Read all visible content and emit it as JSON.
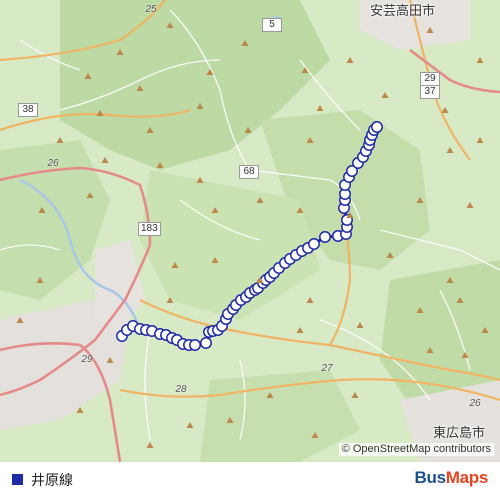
{
  "map": {
    "places": [
      {
        "id": "akitakata",
        "label": "安芸高田市"
      },
      {
        "id": "higashihiroshima",
        "label": "東広島市"
      }
    ],
    "road_shields": [
      {
        "id": "r25",
        "label": "25",
        "style": "plain"
      },
      {
        "id": "r5",
        "label": "5",
        "style": "box"
      },
      {
        "id": "r29a",
        "label": "29",
        "style": "box"
      },
      {
        "id": "r37",
        "label": "37",
        "style": "box"
      },
      {
        "id": "r38",
        "label": "38",
        "style": "box"
      },
      {
        "id": "r26",
        "label": "26",
        "style": "plain"
      },
      {
        "id": "r68",
        "label": "68",
        "style": "box"
      },
      {
        "id": "r183",
        "label": "183",
        "style": "box"
      },
      {
        "id": "r29b",
        "label": "29",
        "style": "plain"
      },
      {
        "id": "r28",
        "label": "28",
        "style": "plain"
      },
      {
        "id": "r27",
        "label": "27",
        "style": "plain"
      },
      {
        "id": "r26b",
        "label": "26",
        "style": "plain"
      }
    ],
    "route_color": "#1f2aa6",
    "stop_fill": "#ffffff",
    "land_color": "#cfe6bb",
    "urban_color": "#e7e3df",
    "attribution": "© OpenStreetMap contributors"
  },
  "legend": {
    "route_name": "井原線",
    "swatch_color": "#1f2aa6"
  },
  "brand": {
    "part1": "Bus",
    "part2": "Maps"
  }
}
